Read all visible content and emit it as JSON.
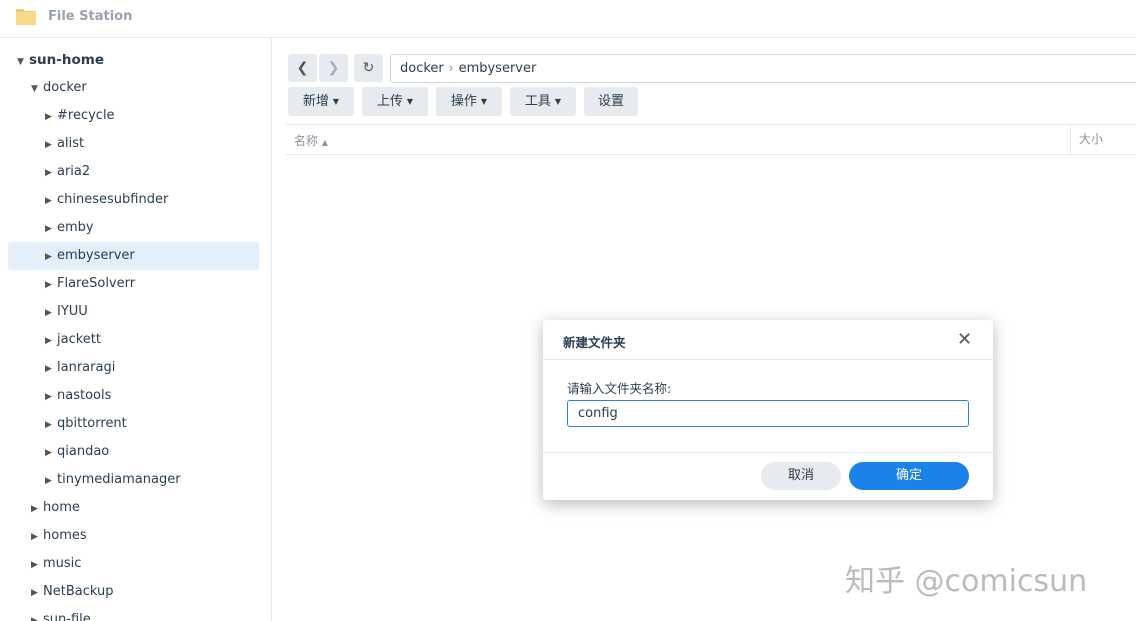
{
  "app": {
    "title": "File Station",
    "icon": "folder-icon"
  },
  "sidebar": {
    "root": "sun-home",
    "docker": "docker",
    "docker_children": [
      "#recycle",
      "alist",
      "aria2",
      "chinesesubfinder",
      "emby",
      "embyserver",
      "FlareSolverr",
      "IYUU",
      "jackett",
      "lanraragi",
      "nastools",
      "qbittorrent",
      "qiandao",
      "tinymediamanager"
    ],
    "selected": "embyserver",
    "siblings": [
      "home",
      "homes",
      "music",
      "NetBackup",
      "sun-file"
    ]
  },
  "path": {
    "segments": [
      "docker",
      "embyserver"
    ]
  },
  "toolbar": {
    "new": "新增",
    "upload": "上传",
    "action": "操作",
    "tools": "工具",
    "settings": "设置"
  },
  "columns": {
    "name": "名称",
    "size": "大小"
  },
  "dialog": {
    "title": "新建文件夹",
    "label": "请输入文件夹名称:",
    "value": "config",
    "cancel": "取消",
    "ok": "确定"
  },
  "watermark": "知乎 @comicsun",
  "colors": {
    "accent": "#1a82e8",
    "selected": "#e3effb"
  }
}
